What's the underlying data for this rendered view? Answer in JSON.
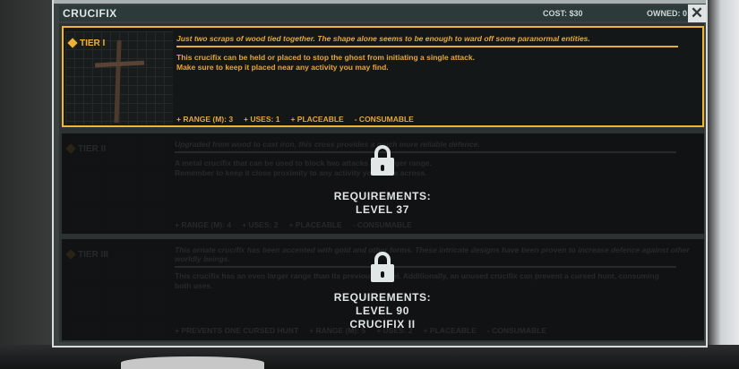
{
  "header": {
    "title": "CRUCIFIX",
    "cost": "COST: $30",
    "owned": "OWNED: 0",
    "close_icon": "close-icon"
  },
  "tiers": [
    {
      "name": "TIER I",
      "flavor": "Just two scraps of wood tied together. The shape alone seems to be enough to ward off some paranormal entities.",
      "desc1": "This crucifix can be held or placed to stop the ghost from initiating a single attack.",
      "desc2": "Make sure to keep it placed near any activity you may find.",
      "stats": [
        "+ RANGE (M): 3",
        "+ USES: 1",
        "+ PLACEABLE",
        "- CONSUMABLE"
      ],
      "locked": false
    },
    {
      "name": "TIER II",
      "flavor": "Upgraded from wood to cast iron, this cross provides a much more reliable defence.",
      "desc1": "A metal crucifix that can be used to block two attacks at a larger range.",
      "desc2": "Remember to keep it close proximity to any activity you come across.",
      "stats": [
        "+ RANGE (M): 4",
        "+ USES: 2",
        "+ PLACEABLE",
        "- CONSUMABLE"
      ],
      "locked": true,
      "requirements": [
        "REQUIREMENTS:",
        "LEVEL 37"
      ]
    },
    {
      "name": "TIER III",
      "flavor": "This ornate crucifix has been accented with gold and other forms. These intricate designs have been proven to increase defence against other worldly beings.",
      "desc1": "This crucifix has an even larger range than its previous model. Additionally, an unused crucifix can prevent a cursed hunt, consuming both uses.",
      "desc2": "",
      "stats": [
        "+ PREVENTS ONE CURSED HUNT",
        "+ RANGE (M): 5",
        "+ USES: 2",
        "+ PLACEABLE",
        "- CONSUMABLE"
      ],
      "locked": true,
      "requirements": [
        "REQUIREMENTS:",
        "LEVEL 90",
        "CRUCIFIX II"
      ]
    }
  ],
  "colors": {
    "accent": "#f1b62f",
    "panel": "#3b4140",
    "text_light": "#dfe6e4"
  },
  "icons": {
    "tier_marker": "diamond-icon",
    "lock": "lock-icon"
  }
}
